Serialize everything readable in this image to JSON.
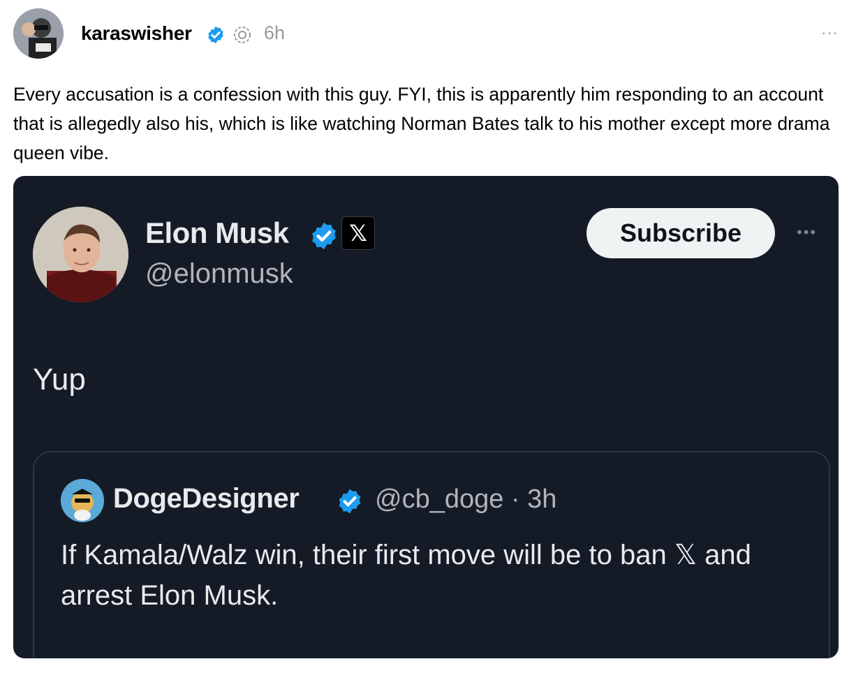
{
  "post": {
    "username": "karaswisher",
    "time": "6h",
    "more": "···",
    "text": "Every accusation is a confession with this guy. FYI, this is apparently him responding to an account that is allegedly also his, which is like watching Norman Bates talk to his mother except more drama queen vibe."
  },
  "embed": {
    "author_name": "Elon Musk",
    "x_badge": "𝕏",
    "handle": "@elonmusk",
    "subscribe_label": "Subscribe",
    "more": "•••",
    "text": "Yup",
    "quote": {
      "author_name": "DogeDesigner",
      "handle_time": "@cb_doge · 3h",
      "text": "If Kamala/Walz win, their first move will be to ban 𝕏 and arrest Elon Musk."
    }
  },
  "colors": {
    "verified_blue": "#1d9bf0",
    "embed_bg": "#141b26",
    "muted_gray": "#999999"
  },
  "icons": [
    "user-avatar",
    "verified-badge-icon",
    "threads-icon",
    "more-icon",
    "x-logo-icon"
  ]
}
